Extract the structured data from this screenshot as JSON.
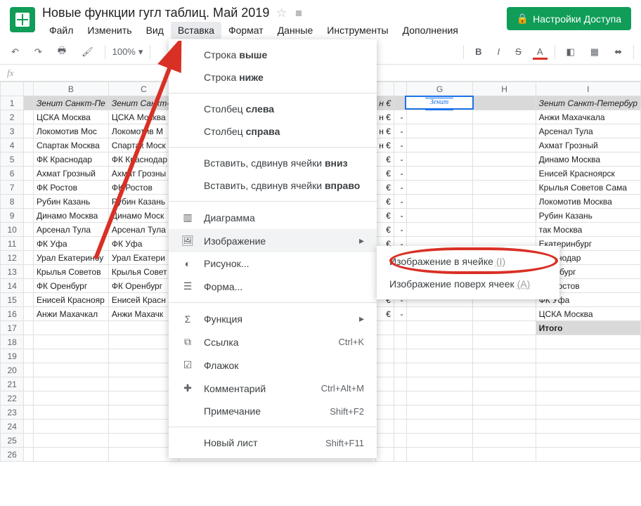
{
  "header": {
    "doc_title": "Новые функции гугл таблиц. Май 2019",
    "share_button": "Настройки Доступа"
  },
  "menubar": [
    "Файл",
    "Изменить",
    "Вид",
    "Вставка",
    "Формат",
    "Данные",
    "Инструменты",
    "Дополнения"
  ],
  "toolbar": {
    "zoom": "100%"
  },
  "fx_label": "fx",
  "columns": [
    "",
    "B",
    "C",
    "",
    "",
    "",
    "G",
    "H",
    "I"
  ],
  "rows": [
    {
      "n": 1,
      "B": "Зенит Санкт-Пе",
      "C": "Зенит Санкт-П",
      "E": "н €",
      "F": "",
      "G": "",
      "H": "",
      "I": "Зенит Санкт-Петербур"
    },
    {
      "n": 2,
      "B": "ЦСКА Москва",
      "C": "ЦСКА Москва",
      "E": "н €",
      "F": "-",
      "G": "",
      "H": "",
      "I": "Анжи Махачкала"
    },
    {
      "n": 3,
      "B": "Локомотив Мос",
      "C": "Локомотив М",
      "E": "н €",
      "F": "-",
      "G": "",
      "H": "",
      "I": "Арсенал Тула"
    },
    {
      "n": 4,
      "B": "Спартак Москва",
      "C": "Спартак Моск",
      "E": "н €",
      "F": "-",
      "G": "",
      "H": "",
      "I": "Ахмат Грозный"
    },
    {
      "n": 5,
      "B": "ФК Краснодар",
      "C": "ФК Краснодар",
      "E": "€",
      "F": "-",
      "G": "",
      "H": "",
      "I": "Динамо Москва"
    },
    {
      "n": 6,
      "B": "Ахмат Грозный",
      "C": "Ахмат Грозны",
      "E": "€",
      "F": "-",
      "G": "",
      "H": "",
      "I": "Енисей Красноярск"
    },
    {
      "n": 7,
      "B": "ФК Ростов",
      "C": "ФК Ростов",
      "E": "€",
      "F": "-",
      "G": "",
      "H": "",
      "I": "Крылья Советов Сама"
    },
    {
      "n": 8,
      "B": "Рубин Казань",
      "C": "Рубин Казань",
      "E": "€",
      "F": "-",
      "G": "",
      "H": "",
      "I": "Локомотив Москва"
    },
    {
      "n": 9,
      "B": "Динамо Москва",
      "C": "Динамо Моск",
      "E": "€",
      "F": "-",
      "G": "",
      "H": "",
      "I": "Рубин Казань"
    },
    {
      "n": 10,
      "B": "Арсенал Тула",
      "C": "Арсенал Тула",
      "E": "€",
      "F": "-",
      "G": "",
      "H": "",
      "I": "так Москва"
    },
    {
      "n": 11,
      "B": "ФК Уфа",
      "C": "ФК Уфа",
      "E": "€",
      "F": "-",
      "G": "",
      "H": "",
      "I": "Екатеринбург"
    },
    {
      "n": 12,
      "B": "Урал Екатеринбу",
      "C": "Урал Екатери",
      "E": "€",
      "F": "-",
      "G": "",
      "H": "",
      "I": "Краснодар"
    },
    {
      "n": 13,
      "B": "Крылья Советов",
      "C": "Крылья Совет",
      "E": "€",
      "F": "-",
      "G": "",
      "H": "",
      "I": "Оренбург"
    },
    {
      "n": 14,
      "B": "ФК Оренбург",
      "C": "ФК Оренбург",
      "E": "€",
      "F": "-",
      "G": "",
      "H": "",
      "I": "ФК Ростов"
    },
    {
      "n": 15,
      "B": "Енисей Краснояр",
      "C": "Енисей Красн",
      "E": "€",
      "F": "-",
      "G": "",
      "H": "",
      "I": "ФК Уфа"
    },
    {
      "n": 16,
      "B": "Анжи Махачкал",
      "C": "Анжи Махачк",
      "E": "€",
      "F": "-",
      "G": "",
      "H": "",
      "I": "ЦСКА Москва"
    },
    {
      "n": 17,
      "B": "",
      "C": "",
      "E": "",
      "F": "",
      "G": "",
      "H": "",
      "I": "Итого"
    },
    {
      "n": 18
    },
    {
      "n": 19
    },
    {
      "n": 20
    },
    {
      "n": 21
    },
    {
      "n": 22
    },
    {
      "n": 23
    },
    {
      "n": 24
    },
    {
      "n": 25
    },
    {
      "n": 26
    }
  ],
  "dropdown": {
    "row_above": {
      "pre": "Строка",
      "bold": "выше"
    },
    "row_below": {
      "pre": "Строка",
      "bold": "ниже"
    },
    "col_left": {
      "pre": "Столбец",
      "bold": "слева"
    },
    "col_right": {
      "pre": "Столбец",
      "bold": "справа"
    },
    "shift_down": {
      "pre": "Вставить, сдвинув ячейки",
      "bold": "вниз"
    },
    "shift_right": {
      "pre": "Вставить, сдвинув ячейки",
      "bold": "вправо"
    },
    "chart": "Диаграмма",
    "image": "Изображение",
    "drawing": "Рисунок...",
    "form": "Форма...",
    "function": "Функция",
    "link": "Ссылка",
    "link_sc": "Ctrl+K",
    "checkbox": "Флажок",
    "comment": "Комментарий",
    "comment_sc": "Ctrl+Alt+M",
    "note": "Примечание",
    "note_sc": "Shift+F2",
    "newsheet": "Новый лист",
    "newsheet_sc": "Shift+F11"
  },
  "submenu": {
    "in_cell": "Изображение в ячейке",
    "in_cell_hint": "(I)",
    "over": "Изображение поверх ячеек",
    "over_hint": "(A)"
  },
  "selected_cell_text": "Зенит"
}
